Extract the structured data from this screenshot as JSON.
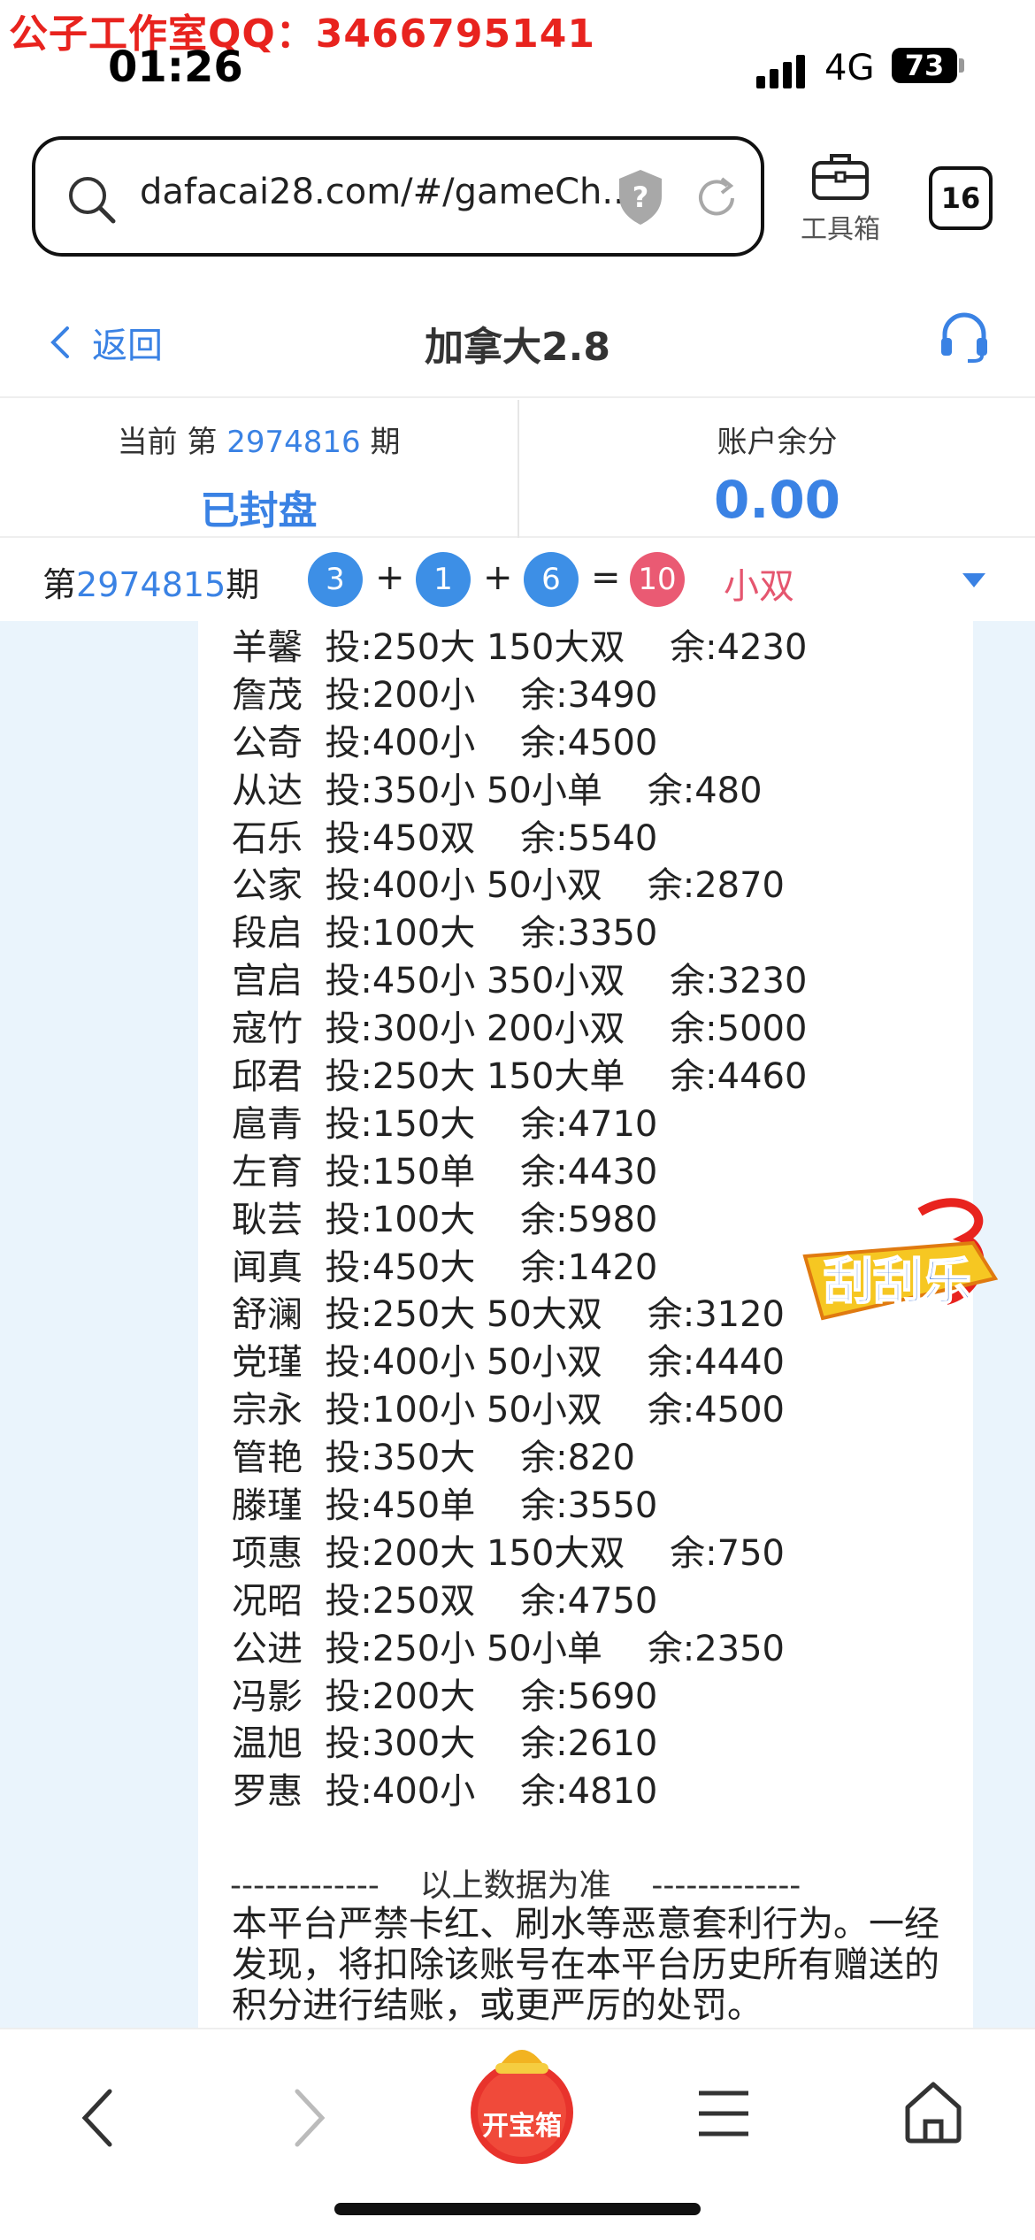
{
  "watermark": "公子工作室QQ：3466795141",
  "status_bar": {
    "time": "01:26",
    "network": "4G",
    "battery": "73"
  },
  "browser": {
    "url": "dafacai28.com/#/gameCh...",
    "toolbox_label": "工具箱",
    "tabs_count": "16"
  },
  "nav": {
    "back_label": "返回",
    "title": "加拿大2.8"
  },
  "info": {
    "current_prefix": "当前 第",
    "current_period": "2974816",
    "current_suffix": "期",
    "status": "已封盘",
    "balance_label": "账户余分",
    "balance": "0.00"
  },
  "result": {
    "prefix": "第",
    "period": "2974815",
    "suffix": "期",
    "balls": [
      "3",
      "1",
      "6"
    ],
    "plus": "+",
    "equals": "=",
    "sum": "10",
    "outcome": "小双"
  },
  "bets": [
    "羊馨  投:250大 150大双    余:4230",
    "詹茂  投:200小    余:3490",
    "公奇  投:400小    余:4500",
    "从达  投:350小 50小单    余:480",
    "石乐  投:450双    余:5540",
    "公家  投:400小 50小双    余:2870",
    "段启  投:100大    余:3350",
    "宫启  投:450小 350小双    余:3230",
    "寇竹  投:300小 200小双    余:5000",
    "邱君  投:250大 150大单    余:4460",
    "扈青  投:150大    余:4710",
    "左育  投:150单    余:4430",
    "耿芸  投:100大    余:5980",
    "闻真  投:450大    余:1420",
    "舒澜  投:250大 50大双    余:3120",
    "党瑾  投:400小 50小双    余:4440",
    "宗永  投:100小 50小双    余:4500",
    "管艳  投:350大    余:820",
    "滕瑾  投:450单    余:3550",
    "项惠  投:200大 150大双    余:750",
    "况昭  投:250双    余:4750",
    "公进  投:250小 50小单    余:2350",
    "冯影  投:200大    余:5690",
    "温旭  投:300大    余:2610",
    "罗惠  投:400小    余:4810"
  ],
  "divider": "-------------    以上数据为准    -------------",
  "notice": "本平台严禁卡红、刷水等恶意套利行为。一经发现，将扣除该账号在本平台历史所有赠送的积分进行结账，或更严厉的处罚。",
  "badge_text": "刮刮乐",
  "bottom_bar": {
    "treasure_label": "开宝箱"
  },
  "colors": {
    "accent": "#3a82e4",
    "result_red": "#e5566f",
    "content_bg": "#eaf4fc",
    "watermark": "#e8231e"
  }
}
